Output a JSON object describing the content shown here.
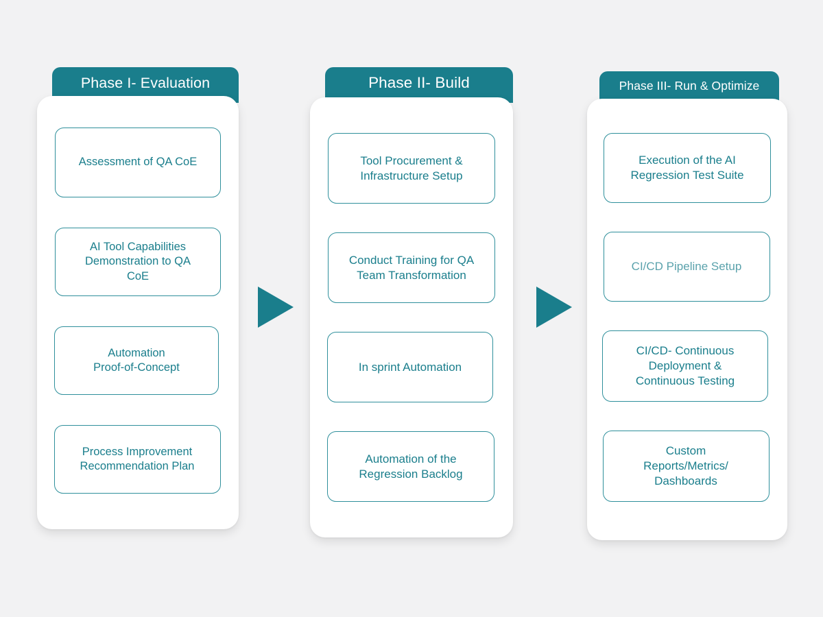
{
  "canvas": {
    "background_color": "#f2f2f3",
    "accent_color": "#1a7e8c",
    "box_border_color": "#2e8f9b",
    "card_color": "#ffffff",
    "tab_text_color": "#ffffff"
  },
  "phases": [
    {
      "id": "phase-1",
      "title": "Phase I- Evaluation",
      "steps": [
        "Assessment of QA CoE",
        "AI Tool Capabilities\nDemonstration to QA\nCoE",
        "Automation\nProof-of-Concept",
        "Process Improvement\nRecommendation Plan"
      ]
    },
    {
      "id": "phase-2",
      "title": "Phase II- Build",
      "steps": [
        "Tool Procurement &\nInfrastructure Setup",
        "Conduct Training for QA\nTeam Transformation",
        "In sprint Automation",
        "Automation of the\nRegression Backlog"
      ]
    },
    {
      "id": "phase-3",
      "title": "Phase III- Run & Optimize",
      "steps": [
        "Execution of the AI\nRegression Test Suite",
        "CI/CD Pipeline Setup",
        "CI/CD- Continuous\nDeployment &\nContinuous Testing",
        "Custom\nReports/Metrics/\nDashboards"
      ]
    }
  ],
  "connectors": [
    {
      "name": "arrow-phase1-to-phase2",
      "direction": "right"
    },
    {
      "name": "arrow-phase2-to-phase3",
      "direction": "right"
    }
  ]
}
